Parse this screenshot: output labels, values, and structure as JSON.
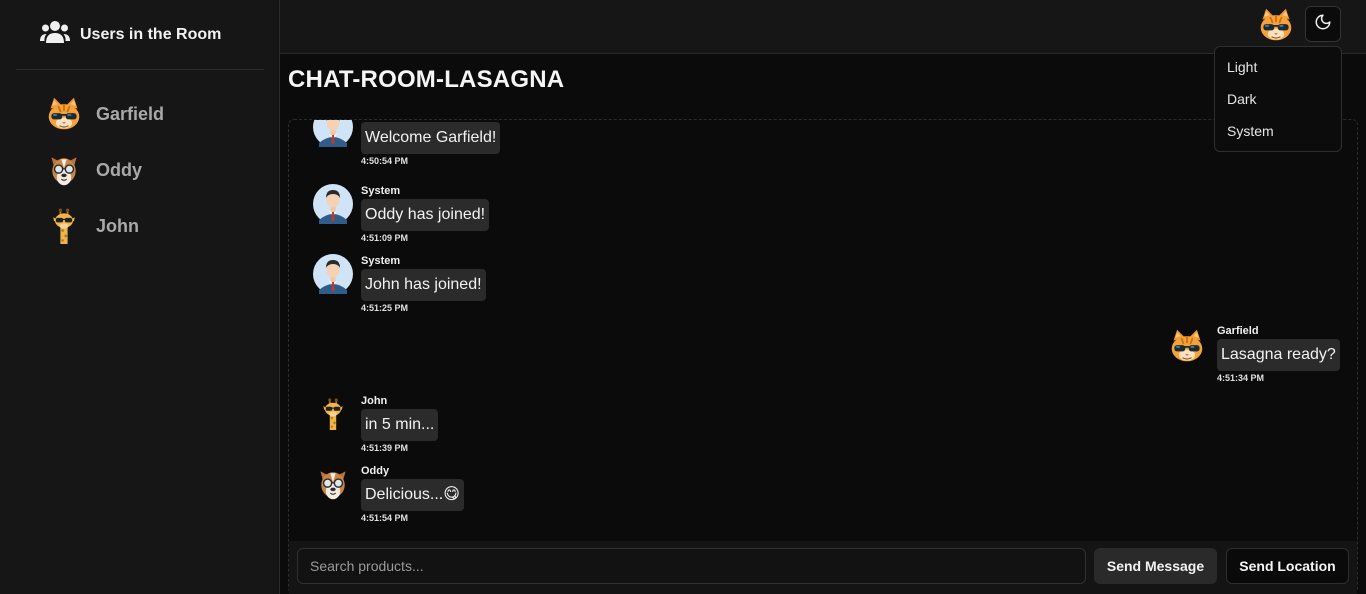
{
  "sidebar": {
    "title": "Users in the Room",
    "icon": "users-icon",
    "users": [
      {
        "name": "Garfield",
        "avatar": "cat-sunglasses-avatar"
      },
      {
        "name": "Oddy",
        "avatar": "dog-glasses-avatar"
      },
      {
        "name": "John",
        "avatar": "giraffe-sunglasses-avatar"
      }
    ]
  },
  "topbar": {
    "avatar": "cat-sunglasses-avatar",
    "theme_icon": "moon-icon",
    "theme_menu": [
      "Light",
      "Dark",
      "System"
    ]
  },
  "room": {
    "title": "CHAT-ROOM-LASAGNA"
  },
  "messages": [
    {
      "sender": "",
      "text": "Welcome Garfield!",
      "time": "4:50:54 PM",
      "side": "left",
      "avatar": "system-user-avatar"
    },
    {
      "sender": "System",
      "text": "Oddy has joined!",
      "time": "4:51:09 PM",
      "side": "left",
      "avatar": "system-user-avatar"
    },
    {
      "sender": "System",
      "text": "John has joined!",
      "time": "4:51:25 PM",
      "side": "left",
      "avatar": "system-user-avatar"
    },
    {
      "sender": "Garfield",
      "text": "Lasagna ready?",
      "time": "4:51:34 PM",
      "side": "right",
      "avatar": "cat-sunglasses-avatar"
    },
    {
      "sender": "John",
      "text": "in 5 min...",
      "time": "4:51:39 PM",
      "side": "left",
      "avatar": "giraffe-sunglasses-avatar"
    },
    {
      "sender": "Oddy",
      "text": "Delicious...😋",
      "time": "4:51:54 PM",
      "side": "left",
      "avatar": "dog-glasses-avatar"
    }
  ],
  "composer": {
    "placeholder": "Search products...",
    "send_label": "Send Message",
    "location_label": "Send Location"
  },
  "colors": {
    "background": "#0b0b0b",
    "panel": "#161616",
    "bubble": "#2b2b2b"
  }
}
